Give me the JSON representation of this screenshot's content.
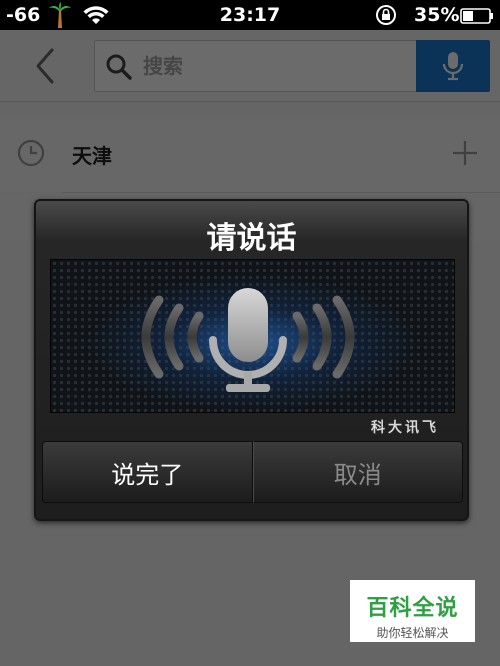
{
  "status_bar": {
    "signal": "-66",
    "time": "23:17",
    "battery_percent": "35%"
  },
  "header": {
    "back_icon": "chevron-left-icon",
    "search": {
      "placeholder": "搜索",
      "value": ""
    },
    "accent_color": "#1a7ad0"
  },
  "history": {
    "items": [
      {
        "label": "天津",
        "icon": "clock-icon",
        "action_icon": "plus-icon"
      }
    ]
  },
  "voice_dialog": {
    "title": "请说话",
    "brand": "科大讯飞",
    "buttons": {
      "done": "说完了",
      "cancel": "取消"
    }
  },
  "watermark": {
    "title": "百科全说",
    "subtitle": "助你轻松解决"
  }
}
